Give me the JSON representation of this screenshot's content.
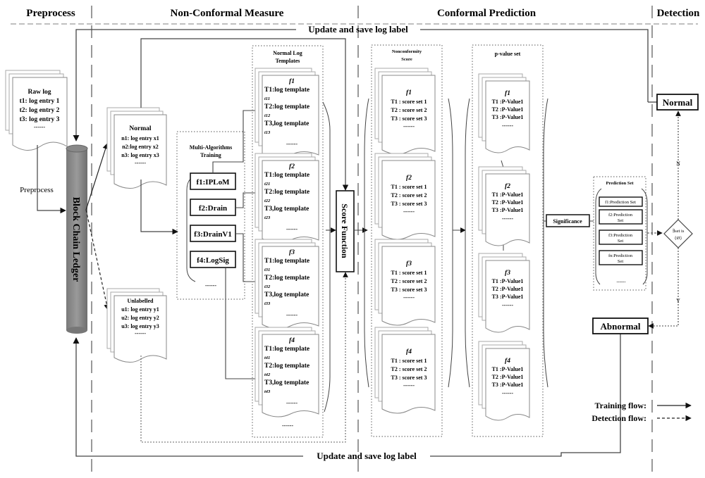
{
  "sections": {
    "preprocess": "Preprocess",
    "non_conformal": "Non-Conformal Measure",
    "conformal": "Conformal Prediction",
    "detection": "Detection"
  },
  "update_label_top": "Update and save log label",
  "update_label_bottom": "Update and save log label",
  "raw_log": {
    "title": "Raw log",
    "entries": [
      "t1: log entry 1",
      "t2: log entry 2",
      "t3: log entry 3"
    ],
    "ellipsis": "------"
  },
  "preprocess_label": "Preprocess",
  "ledger_label": "Block Chain Ledger",
  "normal_doc": {
    "title": "Normal",
    "entries": [
      "n1: log entry x1",
      "n2:log entry  x2",
      "n3: log entry x3"
    ],
    "ellipsis": "------"
  },
  "unlabelled_doc": {
    "title": "Unlabelled",
    "entries": [
      "u1: log entry y1",
      "u2: log entry y2",
      "u3: log entry y3"
    ],
    "ellipsis": "------"
  },
  "training": {
    "title_line1": "Multi-Algorithms",
    "title_line2": "Training",
    "algorithms": [
      "f1:IPLoM",
      "f2:Drain",
      "f3:DrainV1",
      "f4:LogSig"
    ],
    "ellipsis": "------"
  },
  "templates": {
    "title_line1": "Normal Log",
    "title_line2": "Templates",
    "groups": [
      {
        "f": "f1",
        "lines": [
          "T1:log template",
          "t11",
          "T2:log template",
          "t12",
          "T3,log template",
          "t13"
        ]
      },
      {
        "f": "f2",
        "lines": [
          "T1:log template",
          "t21",
          "T2:log template",
          "t22",
          "T3,log template",
          "t23"
        ]
      },
      {
        "f": "f3",
        "lines": [
          "T1:log template",
          "t31",
          "T2:log template",
          "t32",
          "T3,log template",
          "t33"
        ]
      },
      {
        "f": "f4",
        "lines": [
          "T1:log template",
          "t41",
          "T2:log template",
          "t42",
          "T3,log template",
          "t43"
        ]
      }
    ],
    "ellipsis": "------"
  },
  "score_function": "Score Function",
  "nonconformity": {
    "title_line1": "Nonconformity",
    "title_line2": "Score",
    "groups": [
      {
        "f": "f1",
        "lines": [
          "T1 : score set 1",
          "T2 : score set 2",
          "T3 : score set 3"
        ]
      },
      {
        "f": "f2",
        "lines": [
          "T1 : score set 1",
          "T2 : score set 2",
          "T3 : score set 3"
        ]
      },
      {
        "f": "f3",
        "lines": [
          "T1 : score set 1",
          "T2 : score set 2",
          "T3 : score set 3"
        ]
      },
      {
        "f": "f4",
        "lines": [
          "T1 : score set 1",
          "T2 : score set 2",
          "T3 : score set 3"
        ]
      }
    ],
    "ellipsis": "------"
  },
  "pvalues": {
    "title": "p-value set",
    "groups": [
      {
        "f": "f1",
        "lines": [
          "T1 :P-Value1",
          "T2 :P-Value1",
          "T3 :P-Value1"
        ]
      },
      {
        "f": "f2",
        "lines": [
          "T1 :P-Value1",
          "T2 :P-Value1",
          "T3 :P-Value1"
        ]
      },
      {
        "f": "f3",
        "lines": [
          "T1 :P-Value1",
          "T2 :P-Value1",
          "T3 :P-Value1"
        ]
      },
      {
        "f": "f4",
        "lines": [
          "T1 :P-Value1",
          "T2 :P-Value1",
          "T3 :P-Value1"
        ]
      }
    ],
    "ellipsis": "------"
  },
  "significance": "Significance",
  "prediction_set": {
    "title": "Prediction Set",
    "items": [
      {
        "line1": "f1:Prediction Set",
        "line2": ""
      },
      {
        "line1": "f2:Prediction",
        "line2": "Set"
      },
      {
        "line1": "f3:Prediction",
        "line2": "Set"
      },
      {
        "line1": "fn:Prediction",
        "line2": "Set"
      }
    ],
    "ellipsis": "------"
  },
  "decision": {
    "line1": "∃set is",
    "line2": "{Ø}",
    "no": "N",
    "yes": "Y"
  },
  "normal_result": "Normal",
  "abnormal_result": "Abnormal",
  "legend": {
    "training": "Training flow:",
    "detection": "Detection flow:"
  }
}
